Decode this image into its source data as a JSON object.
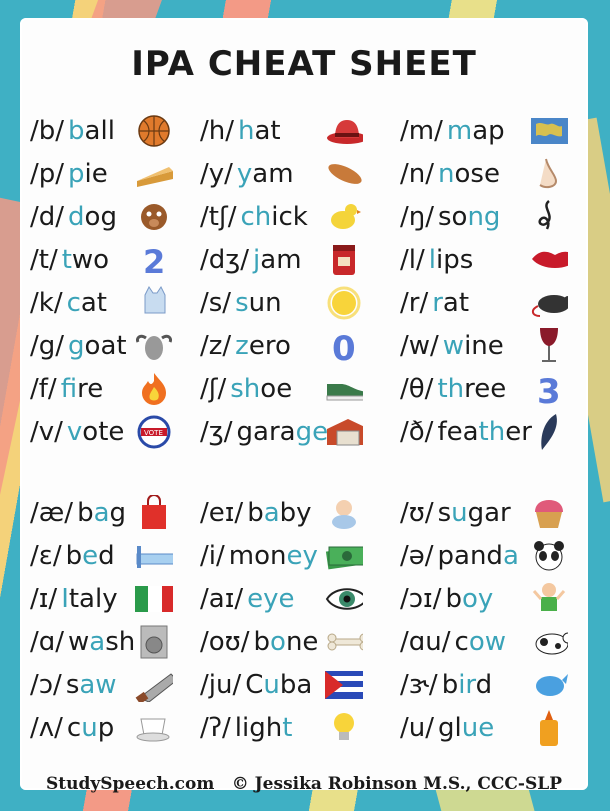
{
  "title": "IPA CHEAT SHEET",
  "footer": {
    "left": "StudySpeech.com",
    "right": "© Jessika Robinson M.S., CCC-SLP"
  },
  "colors": {
    "highlight": "#3aa3b8",
    "text": "#1a1a1a"
  },
  "consonants": [
    [
      {
        "ipa": "/b/",
        "pre": "",
        "hl": "b",
        "post": "all",
        "icon": "basketball-icon"
      },
      {
        "ipa": "/h/",
        "pre": "",
        "hl": "h",
        "post": "at",
        "icon": "hat-icon"
      },
      {
        "ipa": "/m/",
        "pre": "",
        "hl": "m",
        "post": "ap",
        "icon": "map-icon"
      }
    ],
    [
      {
        "ipa": "/p/",
        "pre": "",
        "hl": "p",
        "post": "ie",
        "icon": "pie-icon"
      },
      {
        "ipa": "/y/",
        "pre": "",
        "hl": "y",
        "post": "am",
        "icon": "yam-icon"
      },
      {
        "ipa": "/n/",
        "pre": "",
        "hl": "n",
        "post": "ose",
        "icon": "nose-icon"
      }
    ],
    [
      {
        "ipa": "/d/",
        "pre": "",
        "hl": "d",
        "post": "og",
        "icon": "dog-icon"
      },
      {
        "ipa": "/tʃ/",
        "pre": "",
        "hl": "ch",
        "post": "ick",
        "icon": "chick-icon"
      },
      {
        "ipa": "/ŋ/",
        "pre": "so",
        "hl": "ng",
        "post": "",
        "icon": "music-note-icon"
      }
    ],
    [
      {
        "ipa": "/t/",
        "pre": "",
        "hl": "t",
        "post": "wo",
        "icon": "number-two-icon"
      },
      {
        "ipa": "/dʒ/",
        "pre": "",
        "hl": "j",
        "post": "am",
        "icon": "jam-jar-icon"
      },
      {
        "ipa": "/l/",
        "pre": "",
        "hl": "l",
        "post": "ips",
        "icon": "lips-icon"
      }
    ],
    [
      {
        "ipa": "/k/",
        "pre": "",
        "hl": "c",
        "post": "at",
        "icon": "cat-icon"
      },
      {
        "ipa": "/s/",
        "pre": "",
        "hl": "s",
        "post": "un",
        "icon": "sun-icon"
      },
      {
        "ipa": "/r/",
        "pre": "",
        "hl": "r",
        "post": "at",
        "icon": "rat-icon"
      }
    ],
    [
      {
        "ipa": "/g/",
        "pre": "",
        "hl": "g",
        "post": "oat",
        "icon": "goat-icon"
      },
      {
        "ipa": "/z/",
        "pre": "",
        "hl": "z",
        "post": "ero",
        "icon": "number-zero-icon"
      },
      {
        "ipa": "/w/",
        "pre": "",
        "hl": "w",
        "post": "ine",
        "icon": "wine-glass-icon"
      }
    ],
    [
      {
        "ipa": "/f/",
        "pre": "",
        "hl": "f",
        "post": "ire",
        "icon": "fire-icon"
      },
      {
        "ipa": "/ʃ/",
        "pre": "",
        "hl": "sh",
        "post": "oe",
        "icon": "shoe-icon"
      },
      {
        "ipa": "/θ/",
        "pre": "",
        "hl": "th",
        "post": "ree",
        "icon": "number-three-icon"
      }
    ],
    [
      {
        "ipa": "/v/",
        "pre": "",
        "hl": "v",
        "post": "ote",
        "icon": "vote-badge-icon"
      },
      {
        "ipa": "/ʒ/",
        "pre": "gara",
        "hl": "ge",
        "post": "",
        "icon": "garage-icon"
      },
      {
        "ipa": "/ð/",
        "pre": "fea",
        "hl": "th",
        "post": "er",
        "icon": "feather-icon"
      }
    ]
  ],
  "vowels": [
    [
      {
        "ipa": "/æ/",
        "pre": "b",
        "hl": "a",
        "post": "g",
        "icon": "bag-icon"
      },
      {
        "ipa": "/eɪ/",
        "pre": "b",
        "hl": "a",
        "post": "by",
        "icon": "baby-icon"
      },
      {
        "ipa": "/ʊ/",
        "pre": "s",
        "hl": "u",
        "post": "gar",
        "icon": "cupcake-icon"
      }
    ],
    [
      {
        "ipa": "/ɛ/",
        "pre": "b",
        "hl": "e",
        "post": "d",
        "icon": "bed-icon"
      },
      {
        "ipa": "/i/",
        "pre": "mon",
        "hl": "ey",
        "post": "",
        "icon": "money-icon"
      },
      {
        "ipa": "/ə/",
        "pre": "pand",
        "hl": "a",
        "post": "",
        "icon": "panda-icon"
      }
    ],
    [
      {
        "ipa": "/ɪ/",
        "pre": "",
        "hl": "I",
        "post": "taly",
        "icon": "italy-flag-icon"
      },
      {
        "ipa": "/aɪ/",
        "pre": "",
        "hl": "eye",
        "post": "",
        "icon": "eye-icon"
      },
      {
        "ipa": "/ɔɪ/",
        "pre": "b",
        "hl": "oy",
        "post": "",
        "icon": "boy-icon"
      }
    ],
    [
      {
        "ipa": "/ɑ/",
        "pre": "w",
        "hl": "a",
        "post": "sh",
        "icon": "washer-icon"
      },
      {
        "ipa": "/oʊ/",
        "pre": "b",
        "hl": "o",
        "post": "ne",
        "icon": "bone-icon"
      },
      {
        "ipa": "/ɑu/",
        "pre": "c",
        "hl": "ow",
        "post": "",
        "icon": "cow-icon"
      }
    ],
    [
      {
        "ipa": "/ɔ/",
        "pre": "s",
        "hl": "aw",
        "post": "",
        "icon": "saw-icon"
      },
      {
        "ipa": "/ju/",
        "pre": "C",
        "hl": "u",
        "post": "ba",
        "icon": "cuba-flag-icon"
      },
      {
        "ipa": "/ɝ/",
        "pre": "b",
        "hl": "ir",
        "post": "d",
        "icon": "bird-icon"
      }
    ],
    [
      {
        "ipa": "/ʌ/",
        "pre": "c",
        "hl": "u",
        "post": "p",
        "icon": "cup-icon"
      },
      {
        "ipa": "/ʔ/",
        "pre": "ligh",
        "hl": "t",
        "post": "",
        "icon": "lightbulb-icon"
      },
      {
        "ipa": "/u/",
        "pre": "gl",
        "hl": "ue",
        "post": "",
        "icon": "glue-icon"
      }
    ]
  ]
}
